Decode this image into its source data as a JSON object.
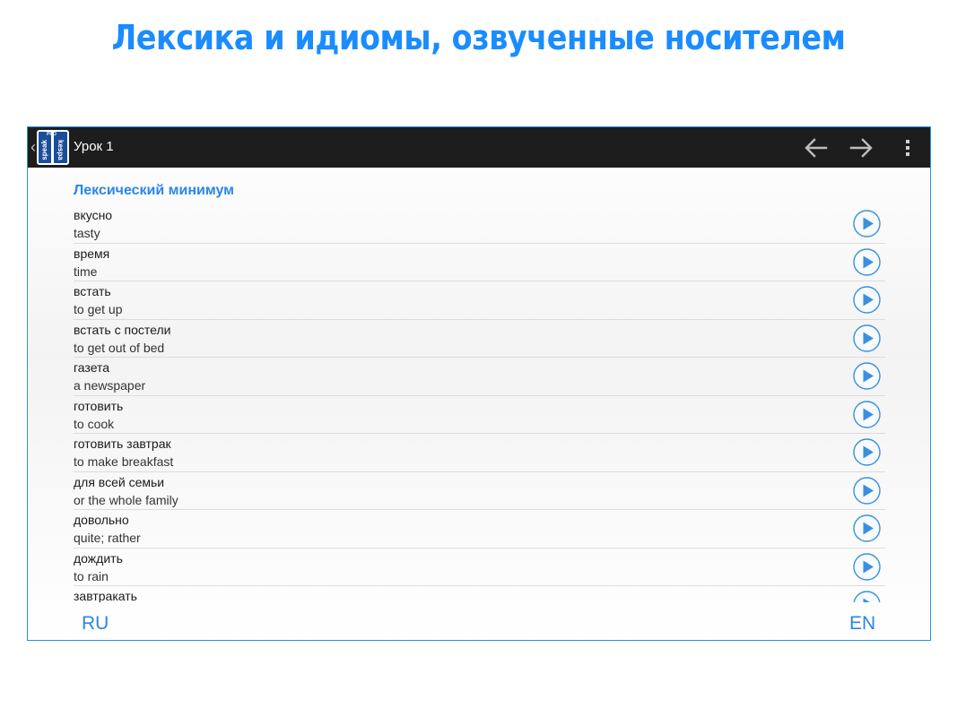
{
  "headline": "Лексика и идиомы, озвученные носителем",
  "app": {
    "title": "Урок 1",
    "icon_words": [
      "speak",
      "kespa"
    ],
    "icon_pro": "PRO"
  },
  "section_title": "Лексический минимум",
  "items": [
    {
      "ru": "вкусно",
      "en": "tasty"
    },
    {
      "ru": "время",
      "en": "time"
    },
    {
      "ru": "встать",
      "en": "to get up"
    },
    {
      "ru": "встать с постели",
      "en": "to get out of bed"
    },
    {
      "ru": "газета",
      "en": "a newspaper"
    },
    {
      "ru": "готовить",
      "en": "to cook"
    },
    {
      "ru": "готовить завтрак",
      "en": "to make breakfast"
    },
    {
      "ru": "для всей семьи",
      "en": "or the whole family"
    },
    {
      "ru": "довольно",
      "en": "quite; rather"
    },
    {
      "ru": "дождить",
      "en": "to rain"
    },
    {
      "ru": "завтракать",
      "en": ""
    }
  ],
  "footer": {
    "left_lang": "RU",
    "right_lang": "EN"
  },
  "colors": {
    "accent": "#2a86e8",
    "headline": "#1a8cff",
    "action_bar": "#1d1d1d",
    "device_border": "#2f8fe6"
  },
  "icons": {
    "back": "arrow-left-icon",
    "forward": "arrow-right-icon",
    "menu": "overflow-menu-icon",
    "play": "play-icon"
  }
}
